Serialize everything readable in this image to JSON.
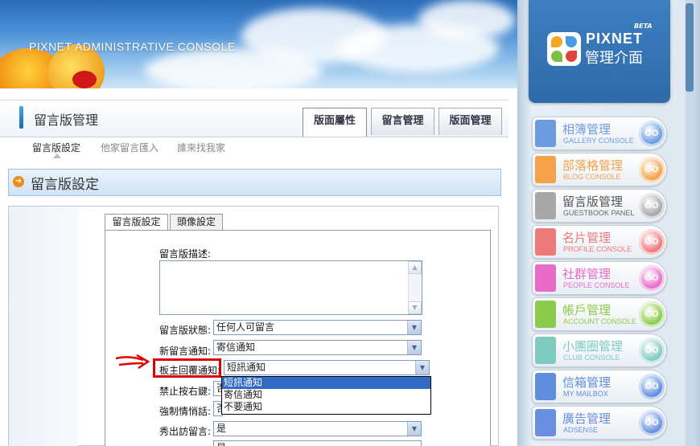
{
  "banner": {
    "title": "PIXNET ADMINISTRATIVE CONSOLE"
  },
  "brand": {
    "beta": "BETA",
    "name": "PIXNET",
    "subtitle": "管理介面"
  },
  "consoles": [
    {
      "zh": "相簿管理",
      "en": "GALLERY CONSOLE",
      "color": "#6d9be0",
      "go": "GO"
    },
    {
      "zh": "部落格管理",
      "en": "BLOG CONSOLE",
      "color": "#f5a24a",
      "go": "GO"
    },
    {
      "zh": "留言版管理",
      "en": "GUESTBOOK PANEL",
      "color": "#a8a8a8",
      "go": "GO"
    },
    {
      "zh": "名片管理",
      "en": "PROFILE CONSOLE",
      "color": "#ee7a7a",
      "go": "GO"
    },
    {
      "zh": "社群管理",
      "en": "PEOPLE CONSOLE",
      "color": "#e76bc7",
      "go": "GO"
    },
    {
      "zh": "帳戶管理",
      "en": "ACCOUNT CONSOLE",
      "color": "#8ccc4a",
      "go": "GO"
    },
    {
      "zh": "小團圈管理",
      "en": "CLUB CONSOLE",
      "color": "#7fcbc0",
      "go": "GO"
    },
    {
      "zh": "信箱管理",
      "en": "MY MAILBOX",
      "color": "#5f8fdc",
      "go": "GO"
    },
    {
      "zh": "廣告管理",
      "en": "ADSENSE",
      "color": "#6a8fe0",
      "go": "GO"
    }
  ],
  "header": {
    "title": "留言版管理",
    "tabs": [
      "版面屬性",
      "留言管理",
      "版面管理"
    ]
  },
  "subnav": [
    "留言版設定",
    "他家留言匯入",
    "誰來找我家"
  ],
  "section": {
    "icon": "➜",
    "title": "留言版設定"
  },
  "inner_tabs": [
    "留言版設定",
    "頭像設定"
  ],
  "form": {
    "description_label": "留言版描述:",
    "status_label": "留言版狀態:",
    "status_value": "任何人可留言",
    "new_notify_label": "新留言通知:",
    "new_notify_value": "寄信通知",
    "reply_notify_label": "板主回覆通知:",
    "reply_notify_value": "短訊通知",
    "disable_rightclick_label": "禁止按右鍵:",
    "disable_rightclick_value": "否",
    "force_label": "強制情悄話:",
    "force_value": "否",
    "show_visitor_label": "秀出訪留言:",
    "show_visitor_value": "是",
    "next_value": "是"
  },
  "dropdown_options": [
    "短訊通知",
    "寄信通知",
    "不要通知"
  ]
}
